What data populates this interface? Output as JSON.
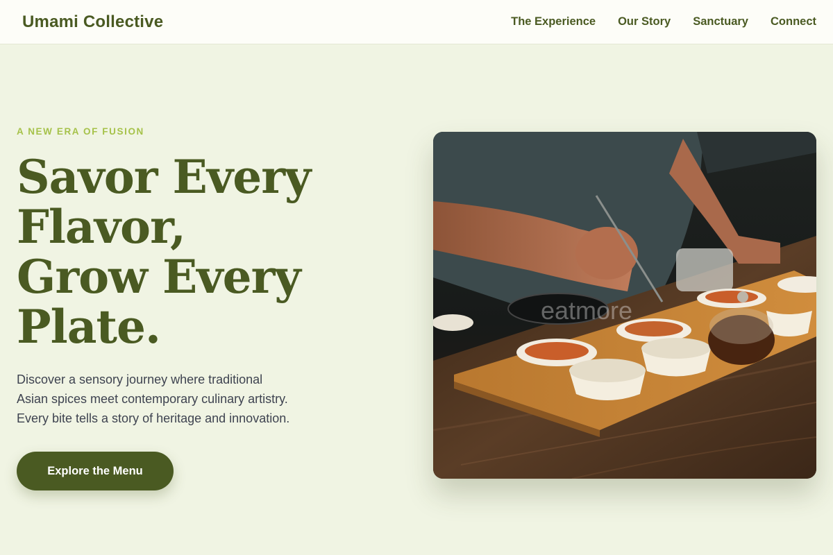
{
  "navbar": {
    "brand": "Umami Collective",
    "links": [
      {
        "label": "The Experience"
      },
      {
        "label": "Our Story"
      },
      {
        "label": "Sanctuary"
      },
      {
        "label": "Connect"
      }
    ]
  },
  "hero": {
    "eyebrow": "A NEW ERA OF FUSION",
    "headline_lines": [
      "Savor Every",
      "Flavor,",
      "Grow Every",
      "Plate."
    ],
    "description_lines": [
      "Discover a sensory journey where traditional",
      "Asian spices meet contemporary culinary artistry.",
      "Every bite tells a story of heritage and innovation."
    ],
    "cta_label": "Explore the Menu",
    "image": {
      "subject": "chef plating dishes on wooden tray",
      "watermark": "eatmore"
    }
  },
  "colors": {
    "background": "#f0f4e3",
    "navbar_bg": "#fdfdf8",
    "brand_green": "#4a5a22",
    "accent_lime": "#a6c24a",
    "body_text": "#3e4350"
  }
}
